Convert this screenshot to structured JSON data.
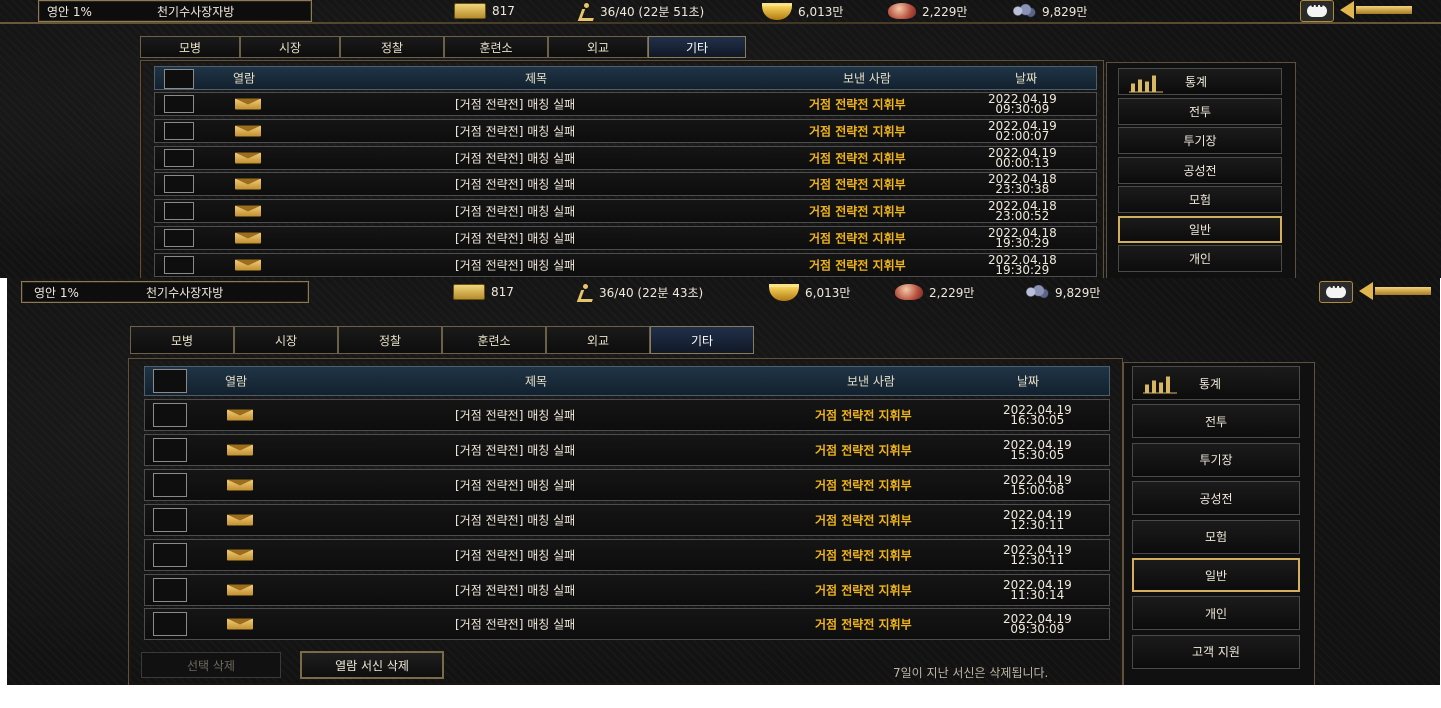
{
  "screens": [
    {
      "hud": {
        "rank": "영안 1%",
        "name": "천기수사장자방",
        "ticket": "817",
        "stamina": "36/40 (22분 51초)",
        "gold": "6,013만",
        "food": "2,229만",
        "ore": "9,829만"
      },
      "tabs": [
        "모병",
        "시장",
        "정찰",
        "훈련소",
        "외교",
        "기타"
      ],
      "active_tab": "기타",
      "table_header": {
        "read": "열람",
        "subject": "제목",
        "sender": "보낸 사람",
        "date": "날짜"
      },
      "rows": [
        {
          "subject": "[거점 전략전] 매칭 실패",
          "sender": "거점 전략전 지휘부",
          "date": "2022.04.19",
          "time": "09:30:09"
        },
        {
          "subject": "[거점 전략전] 매칭 실패",
          "sender": "거점 전략전 지휘부",
          "date": "2022.04.19",
          "time": "02:00:07"
        },
        {
          "subject": "[거점 전략전] 매칭 실패",
          "sender": "거점 전략전 지휘부",
          "date": "2022.04.19",
          "time": "00:00:13"
        },
        {
          "subject": "[거점 전략전] 매칭 실패",
          "sender": "거점 전략전 지휘부",
          "date": "2022.04.18",
          "time": "23:30:38"
        },
        {
          "subject": "[거점 전략전] 매칭 실패",
          "sender": "거점 전략전 지휘부",
          "date": "2022.04.18",
          "time": "23:00:52"
        },
        {
          "subject": "[거점 전략전] 매칭 실패",
          "sender": "거점 전략전 지휘부",
          "date": "2022.04.18",
          "time": "19:30:29"
        },
        {
          "subject": "[거점 전략전] 매칭 실패",
          "sender": "거점 전략전 지휘부",
          "date": "2022.04.18",
          "time": "19:30:29"
        }
      ],
      "side_menu": [
        "통계",
        "전투",
        "투기장",
        "공성전",
        "모험",
        "일반",
        "개인"
      ],
      "active_side": "일반"
    },
    {
      "hud": {
        "rank": "영안 1%",
        "name": "천기수사장자방",
        "ticket": "817",
        "stamina": "36/40 (22분 43초)",
        "gold": "6,013만",
        "food": "2,229만",
        "ore": "9,829만"
      },
      "tabs": [
        "모병",
        "시장",
        "정찰",
        "훈련소",
        "외교",
        "기타"
      ],
      "active_tab": "기타",
      "table_header": {
        "read": "열람",
        "subject": "제목",
        "sender": "보낸 사람",
        "date": "날짜"
      },
      "rows": [
        {
          "subject": "[거점 전략전] 매칭 실패",
          "sender": "거점 전략전 지휘부",
          "date": "2022.04.19",
          "time": "16:30:05"
        },
        {
          "subject": "[거점 전략전] 매칭 실패",
          "sender": "거점 전략전 지휘부",
          "date": "2022.04.19",
          "time": "15:30:05"
        },
        {
          "subject": "[거점 전략전] 매칭 실패",
          "sender": "거점 전략전 지휘부",
          "date": "2022.04.19",
          "time": "15:00:08"
        },
        {
          "subject": "[거점 전략전] 매칭 실패",
          "sender": "거점 전략전 지휘부",
          "date": "2022.04.19",
          "time": "12:30:11"
        },
        {
          "subject": "[거점 전략전] 매칭 실패",
          "sender": "거점 전략전 지휘부",
          "date": "2022.04.19",
          "time": "12:30:11"
        },
        {
          "subject": "[거점 전략전] 매칭 실패",
          "sender": "거점 전략전 지휘부",
          "date": "2022.04.19",
          "time": "11:30:14"
        },
        {
          "subject": "[거점 전략전] 매칭 실패",
          "sender": "거점 전략전 지휘부",
          "date": "2022.04.19",
          "time": "09:30:09"
        }
      ],
      "side_menu": [
        "통계",
        "전투",
        "투기장",
        "공성전",
        "모험",
        "일반",
        "개인",
        "고객 지원"
      ],
      "active_side": "일반",
      "footer": {
        "delete_selected": "선택 삭제",
        "delete_read": "열람 서신 삭제",
        "notice": "7일이 지난 서신은 삭제됩니다."
      }
    }
  ],
  "colors": {
    "sender": "#f0b419",
    "frame": "#5d5240",
    "active_border": "#d4b05e"
  },
  "icons": [
    "ticket-icon",
    "stamina-runner-icon",
    "gold-icon",
    "food-icon",
    "ore-icon",
    "chat-icon",
    "back-arrow-icon",
    "envelope-icon",
    "stats-chart-icon"
  ]
}
